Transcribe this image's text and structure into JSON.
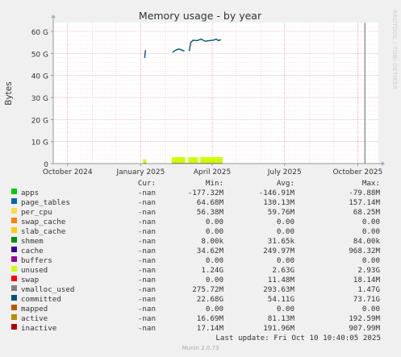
{
  "chart_data": {
    "type": "area",
    "title": "Memory usage - by year",
    "ylabel": "Bytes",
    "ylim": [
      0,
      64
    ],
    "y_unit": "G",
    "y_ticks": [
      {
        "value": 0,
        "label": "0"
      },
      {
        "value": 10,
        "label": "10 G"
      },
      {
        "value": 20,
        "label": "20 G"
      },
      {
        "value": 30,
        "label": "30 G"
      },
      {
        "value": 40,
        "label": "40 G"
      },
      {
        "value": 50,
        "label": "50 G"
      },
      {
        "value": 60,
        "label": "60 G"
      }
    ],
    "x_range": [
      "2024-09-13",
      "2025-10-27"
    ],
    "x_ticks": [
      {
        "date": "2024-10-01",
        "label": "October 2024"
      },
      {
        "date": "2025-01-01",
        "label": "January 2025"
      },
      {
        "date": "2025-04-01",
        "label": "April 2025"
      },
      {
        "date": "2025-07-01",
        "label": "July 2025"
      },
      {
        "date": "2025-10-01",
        "label": "October 2025"
      }
    ],
    "now_marker": "2025-10-10",
    "committed_segments": [
      [
        [
          "2025-01-06",
          48
        ],
        [
          "2025-01-07",
          51.5
        ]
      ],
      [
        [
          "2025-02-10",
          50.5
        ],
        [
          "2025-02-14",
          51.5
        ],
        [
          "2025-02-18",
          52
        ],
        [
          "2025-02-22",
          51.5
        ],
        [
          "2025-02-25",
          51
        ]
      ],
      [
        [
          "2025-03-03",
          51
        ],
        [
          "2025-03-05",
          55
        ],
        [
          "2025-03-08",
          56
        ],
        [
          "2025-03-13",
          55.8
        ],
        [
          "2025-03-18",
          56.5
        ],
        [
          "2025-03-23",
          55.5
        ],
        [
          "2025-03-28",
          55.8
        ],
        [
          "2025-04-02",
          56
        ],
        [
          "2025-04-06",
          56.5
        ],
        [
          "2025-04-09",
          55.8
        ],
        [
          "2025-04-12",
          56.3
        ]
      ]
    ],
    "unused_spans": [
      {
        "start": "2025-01-04",
        "end": "2025-01-08",
        "value": 1.9
      },
      {
        "start": "2025-02-09",
        "end": "2025-02-26",
        "value": 2.93
      },
      {
        "start": "2025-03-02",
        "end": "2025-03-14",
        "value": 2.9
      },
      {
        "start": "2025-03-17",
        "end": "2025-04-14",
        "value": 2.93
      }
    ],
    "base_spans": [
      {
        "start": "2025-01-04",
        "end": "2025-01-08",
        "value": 0.35
      },
      {
        "start": "2025-02-09",
        "end": "2025-04-14",
        "value": 0.35
      }
    ],
    "grid": true,
    "legend_position": "bottom",
    "legend_headers": {
      "cur": "Cur:",
      "min": "Min:",
      "avg": "Avg:",
      "max": "Max:"
    },
    "series": [
      {
        "name": "apps",
        "color": "#00cc00",
        "cur": "-nan",
        "min": "-177.32M",
        "avg": "-146.91M",
        "max": "-79.88M"
      },
      {
        "name": "page_tables",
        "color": "#0066b3",
        "cur": "-nan",
        "min": "64.68M",
        "avg": "130.13M",
        "max": "157.14M"
      },
      {
        "name": "per_cpu",
        "color": "#ffdd44",
        "cur": "-nan",
        "min": "56.38M",
        "avg": "59.76M",
        "max": "68.25M"
      },
      {
        "name": "swap_cache",
        "color": "#ff8000",
        "cur": "-nan",
        "min": "0.00",
        "avg": "0.00",
        "max": "0.00"
      },
      {
        "name": "slab_cache",
        "color": "#ffcc00",
        "cur": "-nan",
        "min": "0.00",
        "avg": "0.00",
        "max": "0.00"
      },
      {
        "name": "shmem",
        "color": "#008f00",
        "cur": "-nan",
        "min": "8.00k",
        "avg": "31.65k",
        "max": "84.00k"
      },
      {
        "name": "cache",
        "color": "#330099",
        "cur": "-nan",
        "min": "34.62M",
        "avg": "249.97M",
        "max": "968.32M"
      },
      {
        "name": "buffers",
        "color": "#990099",
        "cur": "-nan",
        "min": "0.00",
        "avg": "0.00",
        "max": "0.00"
      },
      {
        "name": "unused",
        "color": "#ccff00",
        "cur": "-nan",
        "min": "1.24G",
        "avg": "2.63G",
        "max": "2.93G"
      },
      {
        "name": "swap",
        "color": "#ff0000",
        "cur": "-nan",
        "min": "0.00",
        "avg": "11.48M",
        "max": "18.14M"
      },
      {
        "name": "vmalloc_used",
        "color": "#808080",
        "cur": "-nan",
        "min": "275.72M",
        "avg": "293.63M",
        "max": "1.47G"
      },
      {
        "name": "committed",
        "color": "#005473",
        "cur": "-nan",
        "min": "22.68G",
        "avg": "54.11G",
        "max": "73.71G"
      },
      {
        "name": "mapped",
        "color": "#b35a00",
        "cur": "-nan",
        "min": "0.00",
        "avg": "0.00",
        "max": "0.00"
      },
      {
        "name": "active",
        "color": "#b38f00",
        "cur": "-nan",
        "min": "16.69M",
        "avg": "81.13M",
        "max": "192.59M"
      },
      {
        "name": "inactive",
        "color": "#b30000",
        "cur": "-nan",
        "min": "17.14M",
        "avg": "191.96M",
        "max": "907.99M"
      }
    ]
  },
  "footer": {
    "last_update": "Last update: Fri Oct 10 10:40:05 2025",
    "generator": "Munin 2.0.73",
    "side_label": "RRDTOOL / TOBI OETIKER"
  }
}
